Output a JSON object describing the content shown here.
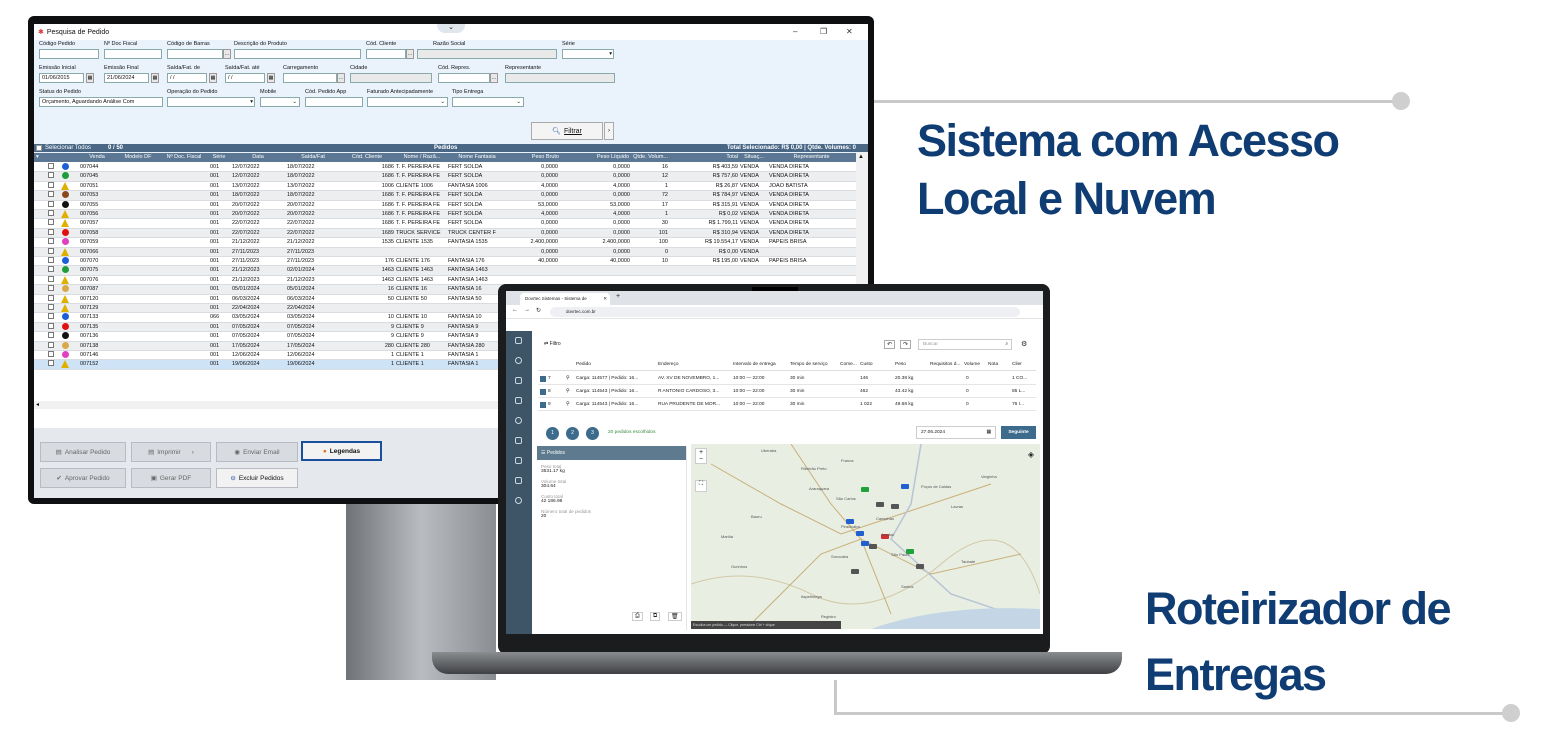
{
  "desktop": {
    "window_title": "Pesquisa de Pedido",
    "filters": {
      "codigo_pedido": "Código Pedido",
      "nr_doc_fiscal": "Nº Doc Fiscal",
      "codigo_barras": "Código de Barras",
      "descricao_produto": "Descrição do Produto",
      "cod_cliente": "Cód. Cliente",
      "razao_social": "Razão Social",
      "serie": "Série",
      "emissao_inicial": "Emissão Inicial",
      "emissao_final": "Emissão Final",
      "saida_fat_de": "Saída/Fat. de",
      "saida_fat_ate": "Saída/Fat. até",
      "carregamento": "Carregamento",
      "cidade": "Cidade",
      "cod_repres": "Cód. Repres.",
      "representante": "Representante",
      "status_pedido": "Status do Pedido",
      "operacao_pedido": "Operação do Pedido",
      "mobile": "Mobile",
      "cod_pedido_app": "Cód. Pedido App",
      "faturado_antecipadamente": "Faturado Antecipadamente",
      "tipo_entrega": "Tipo Entrega",
      "emissao_inicial_value": "01/06/2015",
      "emissao_final_value": "21/06/2024",
      "saida_de_value": "/ /",
      "saida_ate_value": "/ /",
      "status_value": "Orçamento, Aguardando Análise Com",
      "filtrar_button": "Filtrar"
    },
    "grid_header": {
      "select_all": "Selecionar Todos",
      "count": "0 / 50",
      "title": "Pedidos",
      "totals": "Total Selecionado: R$ 0,00 | Qtde. Volumes: 0"
    },
    "columns": [
      "Venda",
      "Modelo DF",
      "Nº Doc. Fiscal",
      "Série",
      "Data",
      "Saída/Fat",
      "Cód. Cliente",
      "Nome / Razã...",
      "Nome Fantasia",
      "Peso Bruto",
      "Peso Líquido",
      "Qtde. Volum...",
      "Total",
      "Situaç...",
      "Representante"
    ],
    "rows": [
      {
        "icon": "#1d5fd6",
        "venda": "007044",
        "serie": "001",
        "data": "12/07/2022",
        "saida": "18/07/2022",
        "cli": "1686",
        "nome": "T. F. PEREIRA FE",
        "fant": "FERT SOLDA",
        "pb": "0,0000",
        "pl": "0,0000",
        "vol": "16",
        "total": "R$ 403,59",
        "sit": "VENDA",
        "rep": "VENDA DIRETA"
      },
      {
        "icon": "#1f9d3a",
        "venda": "007045",
        "serie": "001",
        "data": "12/07/2022",
        "saida": "18/07/2022",
        "cli": "1686",
        "nome": "T. F. PEREIRA FE",
        "fant": "FERT SOLDA",
        "pb": "0,0000",
        "pl": "0,0000",
        "vol": "12",
        "total": "R$ 757,60",
        "sit": "VENDA",
        "rep": "VENDA DIRETA"
      },
      {
        "icon": "warn",
        "venda": "007051",
        "serie": "001",
        "data": "13/07/2022",
        "saida": "13/07/2022",
        "cli": "1006",
        "nome": "CLIENTE 1006",
        "fant": "FANTASIA 1006",
        "pb": "4,0000",
        "pl": "4,0000",
        "vol": "1",
        "total": "R$ 26,87",
        "sit": "VENDA",
        "rep": "JOAO BATISTA"
      },
      {
        "icon": "#8b4a1e",
        "venda": "007053",
        "serie": "001",
        "data": "18/07/2022",
        "saida": "18/07/2022",
        "cli": "1686",
        "nome": "T. F. PEREIRA FE",
        "fant": "FERT SOLDA",
        "pb": "0,0000",
        "pl": "0,0000",
        "vol": "72",
        "total": "R$ 784,97",
        "sit": "VENDA",
        "rep": "VENDA DIRETA"
      },
      {
        "icon": "#111111",
        "venda": "007055",
        "serie": "001",
        "data": "20/07/2022",
        "saida": "20/07/2022",
        "cli": "1686",
        "nome": "T. F. PEREIRA FE",
        "fant": "FERT SOLDA",
        "pb": "53,0000",
        "pl": "53,0000",
        "vol": "17",
        "total": "R$ 315,91",
        "sit": "VENDA",
        "rep": "VENDA DIRETA"
      },
      {
        "icon": "warn",
        "venda": "007056",
        "serie": "001",
        "data": "20/07/2022",
        "saida": "20/07/2022",
        "cli": "1686",
        "nome": "T. F. PEREIRA FE",
        "fant": "FERT SOLDA",
        "pb": "4,0000",
        "pl": "4,0000",
        "vol": "1",
        "total": "R$ 0,02",
        "sit": "VENDA",
        "rep": "VENDA DIRETA"
      },
      {
        "icon": "warn",
        "venda": "007057",
        "serie": "001",
        "data": "22/07/2022",
        "saida": "22/07/2022",
        "cli": "1686",
        "nome": "T. F. PEREIRA FE",
        "fant": "FERT SOLDA",
        "pb": "0,0000",
        "pl": "0,0000",
        "vol": "30",
        "total": "R$ 1.799,11",
        "sit": "VENDA",
        "rep": "VENDA DIRETA"
      },
      {
        "icon": "#e01010",
        "venda": "007058",
        "serie": "001",
        "data": "22/07/2022",
        "saida": "22/07/2022",
        "cli": "1689",
        "nome": "TRUCK SERVICE",
        "fant": "TRUCK CENTER F",
        "pb": "0,0000",
        "pl": "0,0000",
        "vol": "101",
        "total": "R$ 310,94",
        "sit": "VENDA",
        "rep": "VENDA DIRETA"
      },
      {
        "icon": "#e040c0",
        "venda": "007059",
        "serie": "001",
        "data": "21/12/2022",
        "saida": "21/12/2022",
        "cli": "1535",
        "nome": "CLIENTE 1535",
        "fant": "FANTASIA 1535",
        "pb": "2.400,0000",
        "pl": "2.400,0000",
        "vol": "100",
        "total": "R$ 19.554,17",
        "sit": "VENDA",
        "rep": "PAPEIS BRISA"
      },
      {
        "icon": "warn",
        "venda": "007066",
        "serie": "001",
        "data": "27/11/2023",
        "saida": "27/11/2023",
        "cli": "",
        "nome": "",
        "fant": "",
        "pb": "0,0000",
        "pl": "0,0000",
        "vol": "0",
        "total": "R$ 0,00",
        "sit": "VENDA",
        "rep": ""
      },
      {
        "icon": "#1d5fd6",
        "venda": "007070",
        "serie": "001",
        "data": "27/11/2023",
        "saida": "27/11/2023",
        "cli": "176",
        "nome": "CLIENTE 176",
        "fant": "FANTASIA 176",
        "pb": "40,0000",
        "pl": "40,0000",
        "vol": "10",
        "total": "R$ 195,00",
        "sit": "VENDA",
        "rep": "PAPEIS BRISA"
      },
      {
        "icon": "#1f9d3a",
        "venda": "007075",
        "serie": "001",
        "data": "21/12/2023",
        "saida": "02/01/2024",
        "cli": "1463",
        "nome": "CLIENTE 1463",
        "fant": "FANTASIA 1463",
        "pb": "",
        "pl": "",
        "vol": "",
        "total": "",
        "sit": "",
        "rep": ""
      },
      {
        "icon": "warn",
        "venda": "007076",
        "serie": "001",
        "data": "21/12/2023",
        "saida": "21/12/2023",
        "cli": "1463",
        "nome": "CLIENTE 1463",
        "fant": "FANTASIA 1463",
        "pb": "",
        "pl": "",
        "vol": "",
        "total": "",
        "sit": "",
        "rep": ""
      },
      {
        "icon": "#d9a84a",
        "venda": "007087",
        "serie": "001",
        "data": "05/01/2024",
        "saida": "05/01/2024",
        "cli": "16",
        "nome": "CLIENTE 16",
        "fant": "FANTASIA 16",
        "pb": "",
        "pl": "",
        "vol": "",
        "total": "",
        "sit": "",
        "rep": ""
      },
      {
        "icon": "warn",
        "venda": "007120",
        "serie": "001",
        "data": "06/03/2024",
        "saida": "06/03/2024",
        "cli": "50",
        "nome": "CLIENTE 50",
        "fant": "FANTASIA 50",
        "pb": "",
        "pl": "",
        "vol": "",
        "total": "",
        "sit": "",
        "rep": ""
      },
      {
        "icon": "warn",
        "venda": "007129",
        "serie": "001",
        "data": "22/04/2024",
        "saida": "22/04/2024",
        "cli": "",
        "nome": "",
        "fant": "",
        "pb": "",
        "pl": "",
        "vol": "",
        "total": "",
        "sit": "",
        "rep": ""
      },
      {
        "icon": "#1d5fd6",
        "venda": "007133",
        "serie": "066",
        "data": "03/05/2024",
        "saida": "03/05/2024",
        "cli": "10",
        "nome": "CLIENTE 10",
        "fant": "FANTASIA 10",
        "pb": "",
        "pl": "",
        "vol": "",
        "total": "",
        "sit": "",
        "rep": ""
      },
      {
        "icon": "#e01010",
        "venda": "007135",
        "serie": "001",
        "data": "07/05/2024",
        "saida": "07/05/2024",
        "cli": "9",
        "nome": "CLIENTE 9",
        "fant": "FANTASIA 9",
        "pb": "",
        "pl": "",
        "vol": "",
        "total": "",
        "sit": "",
        "rep": ""
      },
      {
        "icon": "#111111",
        "venda": "007136",
        "serie": "001",
        "data": "07/05/2024",
        "saida": "07/05/2024",
        "cli": "9",
        "nome": "CLIENTE 9",
        "fant": "FANTASIA 9",
        "pb": "",
        "pl": "",
        "vol": "",
        "total": "",
        "sit": "",
        "rep": ""
      },
      {
        "icon": "#d9a84a",
        "venda": "007138",
        "serie": "001",
        "data": "17/05/2024",
        "saida": "17/05/2024",
        "cli": "280",
        "nome": "CLIENTE 280",
        "fant": "FANTASIA 280",
        "pb": "",
        "pl": "",
        "vol": "",
        "total": "",
        "sit": "",
        "rep": ""
      },
      {
        "icon": "#e040c0",
        "venda": "007146",
        "serie": "001",
        "data": "12/06/2024",
        "saida": "12/06/2024",
        "cli": "1",
        "nome": "CLIENTE 1",
        "fant": "FANTASIA 1",
        "pb": "",
        "pl": "",
        "vol": "",
        "total": "",
        "sit": "",
        "rep": ""
      },
      {
        "icon": "warn",
        "venda": "007152",
        "serie": "001",
        "data": "19/06/2024",
        "saida": "19/06/2024",
        "cli": "1",
        "nome": "CLIENTE 1",
        "fant": "FANTASIA 1",
        "pb": "",
        "pl": "",
        "vol": "",
        "total": "",
        "sit": "",
        "rep": ""
      }
    ],
    "buttons": {
      "analisar": "Analisar Pedido",
      "imprimir": "Imprimir",
      "enviar_email": "Enviar Email",
      "legendas": "Legendas",
      "aprovar": "Aprovar Pedido",
      "gerar_pdf": "Gerar PDF",
      "excluir": "Excluir Pedidos"
    }
  },
  "laptop": {
    "browser_tab": "Dovrtec Sistemas - Sistema de",
    "url": "dovrtec.com.br",
    "filter_label": "Filtro",
    "search_placeholder": "Buscar",
    "table_headers": [
      "Pedido",
      "Endereço",
      "Intervalo de entrega",
      "Tempo de serviço",
      "Come...",
      "Custo",
      "Peso",
      "Requisitos d...",
      "Volume",
      "Nota",
      "Clier"
    ],
    "rows": [
      {
        "n": "7",
        "pedido": "Carga: 114577 | Pedido: 16...",
        "end": "AV. XV DE NOVEMBRO, 1...",
        "int": "10:00 — 22:00",
        "tempo": "30 min",
        "custo": "146",
        "peso": "20.38 kg",
        "vol": "0",
        "cli": "1 CO..."
      },
      {
        "n": "8",
        "pedido": "Carga: 114543 | Pedido: 16...",
        "end": "R ANTONIO CARDOSO, 3...",
        "int": "10:00 — 22:00",
        "tempo": "30 min",
        "custo": "462",
        "peso": "43.42 kg",
        "vol": "0",
        "cli": "85 L..."
      },
      {
        "n": "9",
        "pedido": "Carga: 114543 | Pedido: 16...",
        "end": "RUA PRUDENTE DE MOR...",
        "int": "10:00 — 22:00",
        "tempo": "30 min",
        "custo": "1 022",
        "peso": "49.68 kg",
        "vol": "0",
        "cli": "76 I..."
      }
    ],
    "pages": [
      "1",
      "2",
      "3"
    ],
    "selected_text": "20 pedidos escolhidos",
    "date": "27.06.2024",
    "next_button": "Seguinte",
    "panel_title": "Pedidos",
    "stats": [
      {
        "label": "Peso total",
        "value": "3531.17 kg"
      },
      {
        "label": "Volume total",
        "value": "304.64"
      },
      {
        "label": "Custo total",
        "value": "42 186.98"
      },
      {
        "label": "Número total de pedidos",
        "value": "20"
      }
    ],
    "map_footer": "Escolha um pedido — Clique, pressione Ctrl + clique",
    "cities": [
      "Uberaba",
      "Ribeirão Preto",
      "Franca",
      "Araraquara",
      "São Carlos",
      "Bauru",
      "Piracicaba",
      "Campinas",
      "São Paulo",
      "Santos",
      "Sorocaba",
      "Jundiaí",
      "Poços de Caldas",
      "Varginha",
      "Lavras",
      "Itapetininga",
      "Ourinhos",
      "Marília",
      "Registro",
      "Taubaté"
    ]
  },
  "headlines": {
    "h1": "Sistema com Acesso",
    "h1b": "Local e Nuvem",
    "h2": "Roteirizador de",
    "h2b": "Entregas"
  }
}
